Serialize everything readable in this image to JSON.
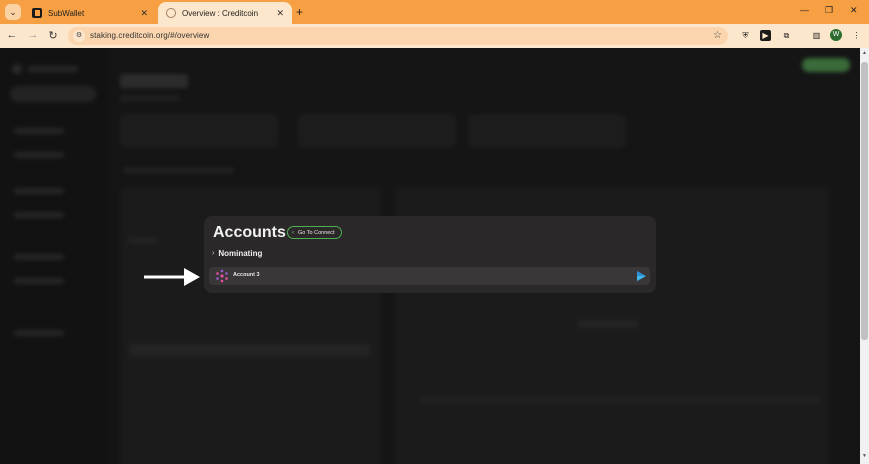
{
  "browser": {
    "tabs": [
      {
        "title": "SubWallet",
        "active": false
      },
      {
        "title": "Overview : Creditcoin",
        "active": true
      }
    ],
    "url": "staking.creditcoin.org/#/overview",
    "profile_initial": "W"
  },
  "modal": {
    "title": "Accounts",
    "go_to_connect_label": "Go To Connect",
    "group_label": "Nominating",
    "accounts": [
      {
        "name": "Account 3"
      }
    ]
  },
  "colors": {
    "browser_frame": "#f7a043",
    "toolbar": "#fde7cc",
    "page_background": "#151515",
    "modal_background": "#2b282a",
    "accent_green": "#4caf50"
  }
}
